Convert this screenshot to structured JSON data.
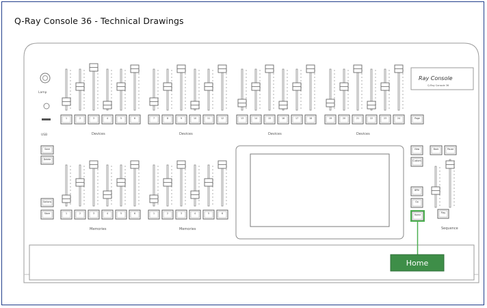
{
  "page": {
    "title": "Q-Ray Console 36 - Technical Drawings"
  },
  "console": {
    "lamp_label": "Lamp",
    "usb_label": "USB",
    "logo_title": "Ray Console",
    "logo_subtitle": "Q-Ray Console 36",
    "device_group_labels": [
      "Devices",
      "Devices",
      "Devices",
      "Devices"
    ],
    "memory_group_labels": [
      "Memories",
      "Memories"
    ],
    "sequence_label": "Sequence",
    "device_button_numbers": [
      "1",
      "2",
      "3",
      "4",
      "5",
      "6",
      "7",
      "8",
      "9",
      "10",
      "11",
      "12",
      "13",
      "14",
      "15",
      "16",
      "17",
      "18",
      "19",
      "20",
      "21",
      "22",
      "23",
      "24"
    ],
    "memory_button_numbers": [
      "1",
      "2",
      "3",
      "4",
      "5",
      "6",
      "1",
      "2",
      "3",
      "4",
      "5",
      "6"
    ],
    "device_page_button": "Page",
    "left_keys_top": [
      "Save",
      "Delete"
    ],
    "left_keys_bottom": [
      "Options",
      "Store"
    ],
    "right_keys_col": [
      "View",
      "Custom"
    ],
    "right_keys_lower": [
      "BPM",
      "Go",
      "Home"
    ],
    "sequence_keys_top": [
      "Back",
      "Pause"
    ],
    "sequence_key_bottom": "Play"
  },
  "callout": {
    "label": "Home",
    "color": "#3e8e48",
    "line_color": "#4caf50"
  }
}
